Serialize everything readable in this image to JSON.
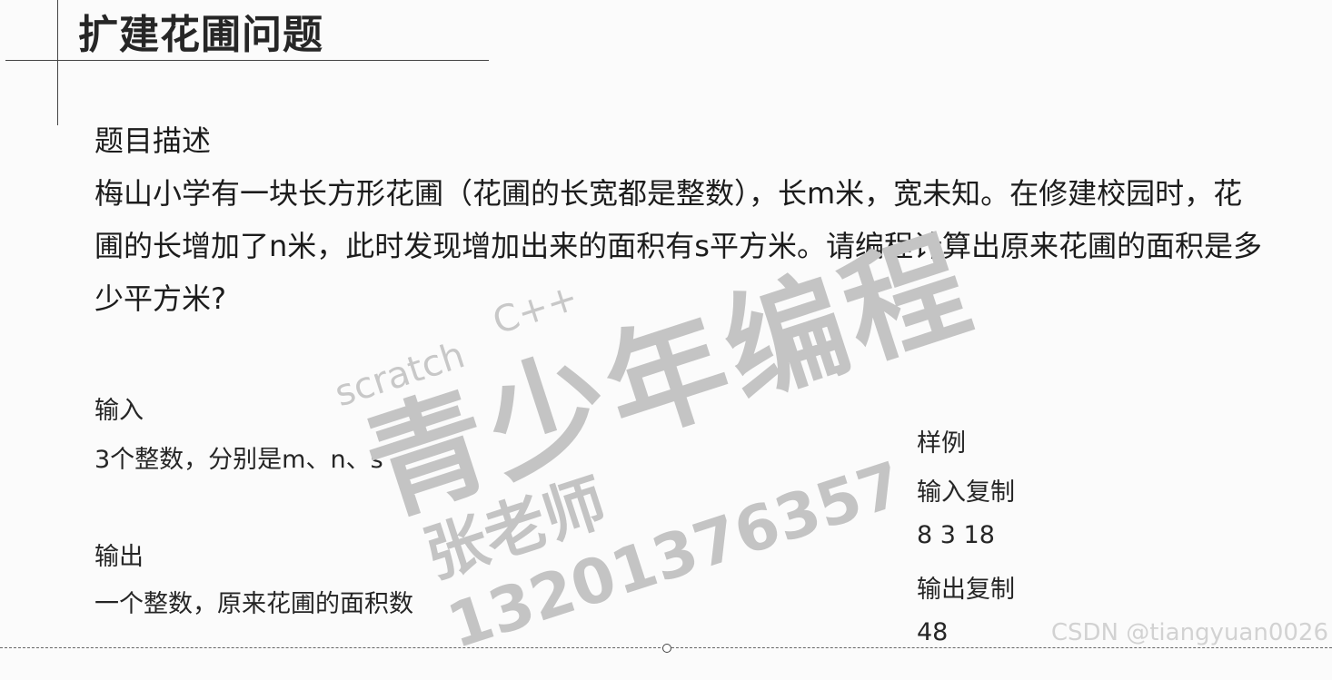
{
  "title": "扩建花圃问题",
  "description_label": "题目描述",
  "description_lines": [
    "梅山小学有一块长方形花圃（花圃的长宽都是整数），长m米，宽未知。在修建校园时，花",
    "圃的长增加了n米，此时发现增加出来的面积有s平方米。请编程计算出原来花圃的面积是多",
    "少平方米?"
  ],
  "input": {
    "label": "输入",
    "text": "3个整数，分别是m、n、s"
  },
  "output": {
    "label": "输出",
    "text": "一个整数，原来花圃的面积数"
  },
  "sample": {
    "label": "样例",
    "input_label": "输入复制",
    "input_value": "8 3 18",
    "output_label": "输出复制",
    "output_value": "48"
  },
  "watermark": {
    "scratch": "scratch",
    "cpp": "C++",
    "brand": "青少年编程",
    "teacher": "张老师13201376357"
  },
  "csdn_watermark": "CSDN @tiangyuan0026"
}
